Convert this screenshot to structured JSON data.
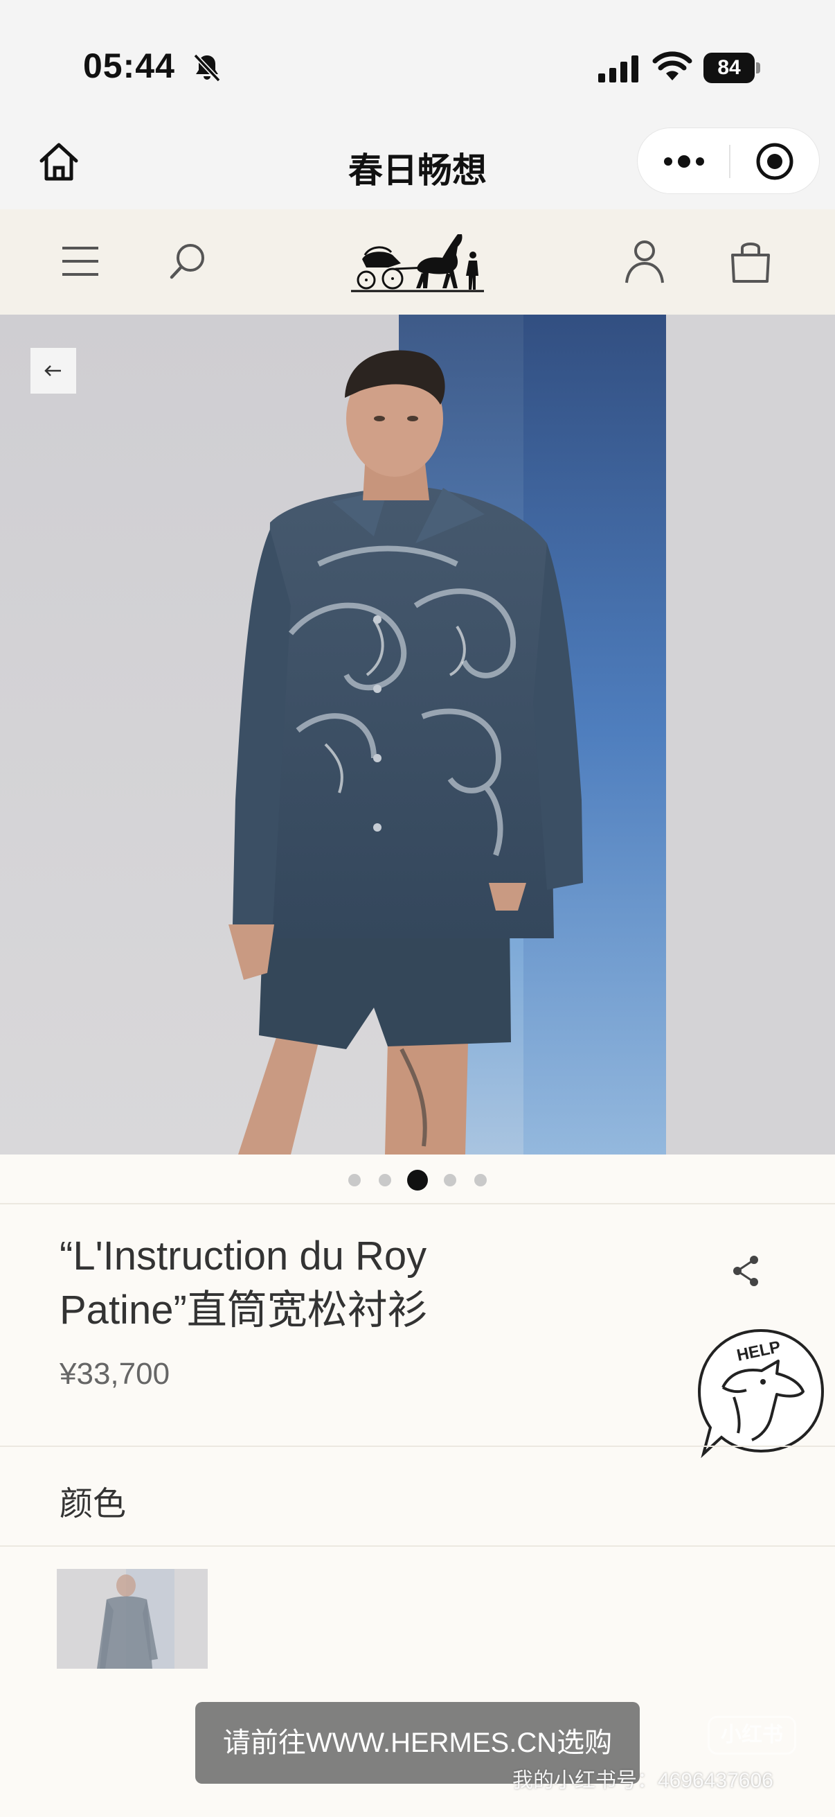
{
  "status_bar": {
    "time": "05:44",
    "battery": "84",
    "icons": [
      "bell-slash-icon",
      "cellular-signal-icon",
      "wifi-icon",
      "battery-icon"
    ]
  },
  "mini_program": {
    "title": "春日畅想",
    "icons": [
      "home-icon",
      "more-icon",
      "target-icon"
    ]
  },
  "site_nav": {
    "icons": [
      "menu-icon",
      "search-icon",
      "hermes-carriage-logo",
      "user-icon",
      "shopping-bag-icon"
    ]
  },
  "hero": {
    "carousel_total": 5,
    "carousel_active_index": 2,
    "back_icon": "arrow-left-icon"
  },
  "product": {
    "title_line1": "“L'Instruction du Roy",
    "title_line2": "Patine”直筒宽松衬衫",
    "price": "¥33,700",
    "share_icon": "share-icon",
    "help_icon": "help-horse-icon"
  },
  "color_section": {
    "label": "颜色"
  },
  "toast": {
    "text": "请前往WWW.HERMES.CN选购"
  },
  "watermark": {
    "logo_text": "小红书",
    "id_text": "我的小红书号：4696437606"
  },
  "colors": {
    "background": "#fcfaf6",
    "nav_background": "#f4f1ea",
    "shirt": "#3d5066",
    "accent_blue": "#4f78b0"
  }
}
